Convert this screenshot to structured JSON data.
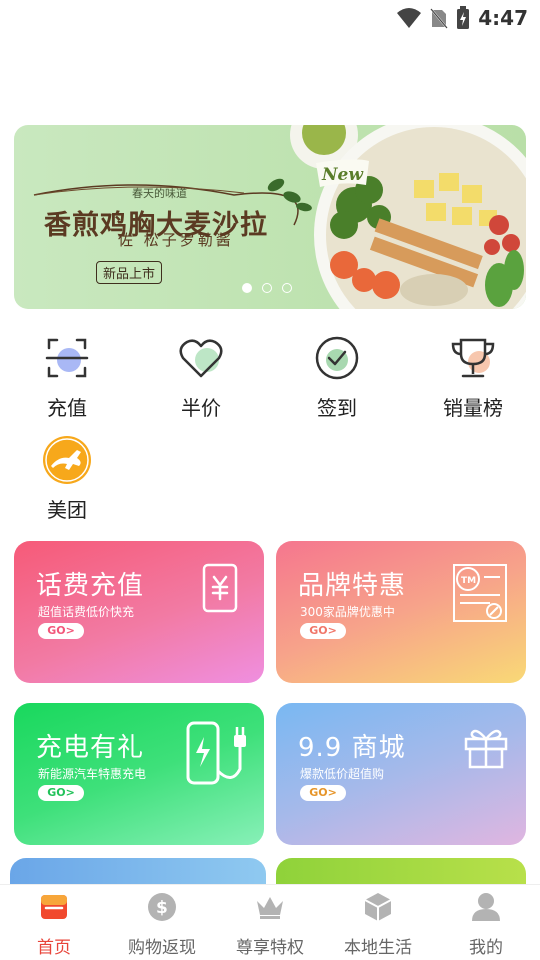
{
  "status_bar": {
    "time": "4:47"
  },
  "banner": {
    "cursive_top": "春天的味道",
    "headline": "香煎鸡胸大麦沙拉",
    "subtitle": "佐 松子罗勒酱",
    "tag": "新品上市",
    "badge": "New",
    "dots": 3,
    "active_dot": 0
  },
  "quick_nav": [
    {
      "label": "充值",
      "icon": "scan-icon"
    },
    {
      "label": "半价",
      "icon": "heart-icon"
    },
    {
      "label": "签到",
      "icon": "check-circle-icon"
    },
    {
      "label": "销量榜",
      "icon": "trophy-icon"
    },
    {
      "label": "美团",
      "icon": "kangaroo-icon"
    }
  ],
  "cards": [
    {
      "title": "话费充值",
      "desc": "超值话费低价快充",
      "go": "GO>",
      "icon": "yuan-phone-icon"
    },
    {
      "title": "品牌特惠",
      "desc": "300家品牌优惠中",
      "go": "GO>",
      "icon": "tm-certificate-icon"
    },
    {
      "title": "充电有礼",
      "desc": "新能源汽车特惠充电",
      "go": "GO>",
      "icon": "charging-station-icon"
    },
    {
      "title": "9.9 商城",
      "desc": "爆款低价超值购",
      "go": "GO>",
      "icon": "gift-icon"
    }
  ],
  "bottom_nav": [
    {
      "label": "首页",
      "icon": "home-icon",
      "active": true
    },
    {
      "label": "购物返现",
      "icon": "dollar-icon",
      "active": false
    },
    {
      "label": "尊享特权",
      "icon": "crown-icon",
      "active": false
    },
    {
      "label": "本地生活",
      "icon": "cube-icon",
      "active": false
    },
    {
      "label": "我的",
      "icon": "user-icon",
      "active": false
    }
  ],
  "colors": {
    "active": "#e8443a",
    "inactive": "#b0b0b0"
  }
}
